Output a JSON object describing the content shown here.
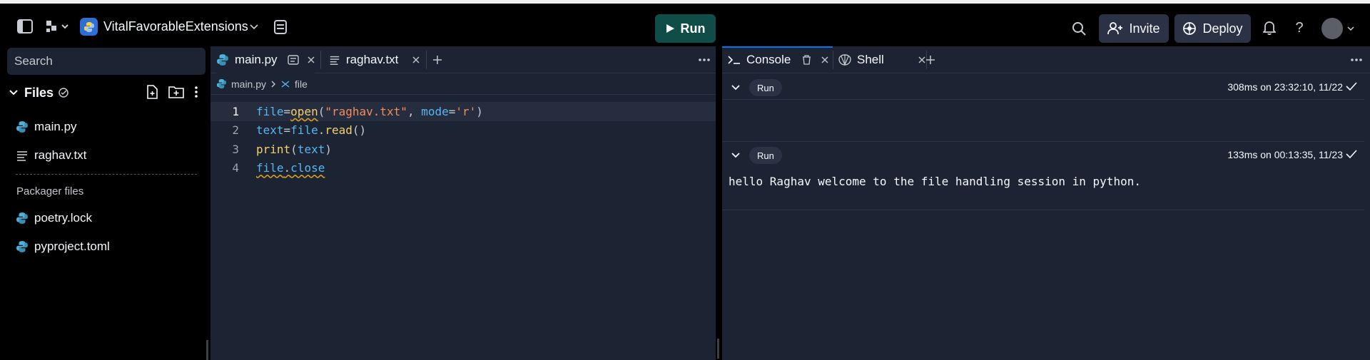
{
  "header": {
    "project_name": "VitalFavorableExtensions",
    "run_label": "Run",
    "invite_label": "Invite",
    "deploy_label": "Deploy",
    "help_glyph": "?"
  },
  "sidebar": {
    "search_placeholder": "Search",
    "files_title": "Files",
    "files": [
      {
        "name": "main.py",
        "icon": "python-icon"
      },
      {
        "name": "raghav.txt",
        "icon": "text-file-icon"
      }
    ],
    "packager_label": "Packager files",
    "packager_files": [
      {
        "name": "poetry.lock",
        "icon": "python-icon"
      },
      {
        "name": "pyproject.toml",
        "icon": "python-icon"
      }
    ]
  },
  "editor": {
    "tabs": [
      {
        "label": "main.py",
        "active": true
      },
      {
        "label": "raghav.txt",
        "active": false
      }
    ],
    "breadcrumb": {
      "file": "main.py",
      "symbol": "file"
    },
    "line_numbers": [
      "1",
      "2",
      "3",
      "4"
    ],
    "current_line": 1
  },
  "console": {
    "tabs": [
      {
        "label": "Console",
        "active": true
      },
      {
        "label": "Shell",
        "active": false
      }
    ],
    "runs": [
      {
        "label": "Run",
        "meta": "308ms on 23:32:10, 11/22",
        "output": ""
      },
      {
        "label": "Run",
        "meta": "133ms on 00:13:35, 11/23",
        "output": "hello Raghav welcome to the file handling session in python."
      }
    ]
  },
  "colors": {
    "run_button": "#0f4d46",
    "panel_bg": "#1c2333",
    "accent_tab": "#0079f2"
  }
}
